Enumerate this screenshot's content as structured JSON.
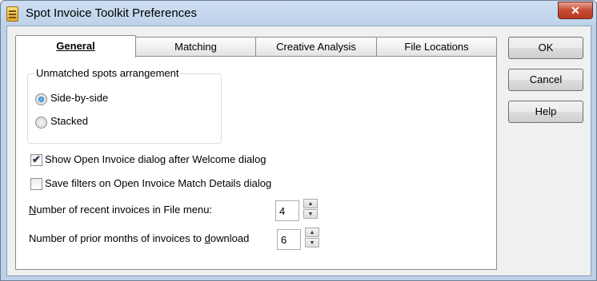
{
  "window": {
    "title": "Spot Invoice Toolkit Preferences",
    "close_glyph": "✕"
  },
  "tabs": [
    {
      "label": "General",
      "active": true
    },
    {
      "label": "Matching",
      "active": false
    },
    {
      "label": "Creative Analysis",
      "active": false
    },
    {
      "label": "File Locations",
      "active": false
    }
  ],
  "general": {
    "group_title": "Unmatched spots arrangement",
    "radio_options": [
      {
        "label": "Side-by-side",
        "checked": true
      },
      {
        "label": "Stacked",
        "checked": false
      }
    ],
    "checkboxes": [
      {
        "label": "Show Open Invoice dialog after Welcome dialog",
        "checked": true
      },
      {
        "label": "Save filters on Open Invoice Match Details dialog",
        "checked": false
      }
    ],
    "recent_invoices": {
      "label_pre": "",
      "label_key": "N",
      "label_post": "umber of recent invoices in File menu:",
      "value": "4"
    },
    "prior_months": {
      "label_pre": "Number of prior months of invoices to ",
      "label_key": "d",
      "label_post": "ownload",
      "value": "6"
    }
  },
  "buttons": {
    "ok": "OK",
    "cancel": "Cancel",
    "help": "Help"
  },
  "glyphs": {
    "check": "✔",
    "spin_up": "▲",
    "spin_down": "▼"
  }
}
